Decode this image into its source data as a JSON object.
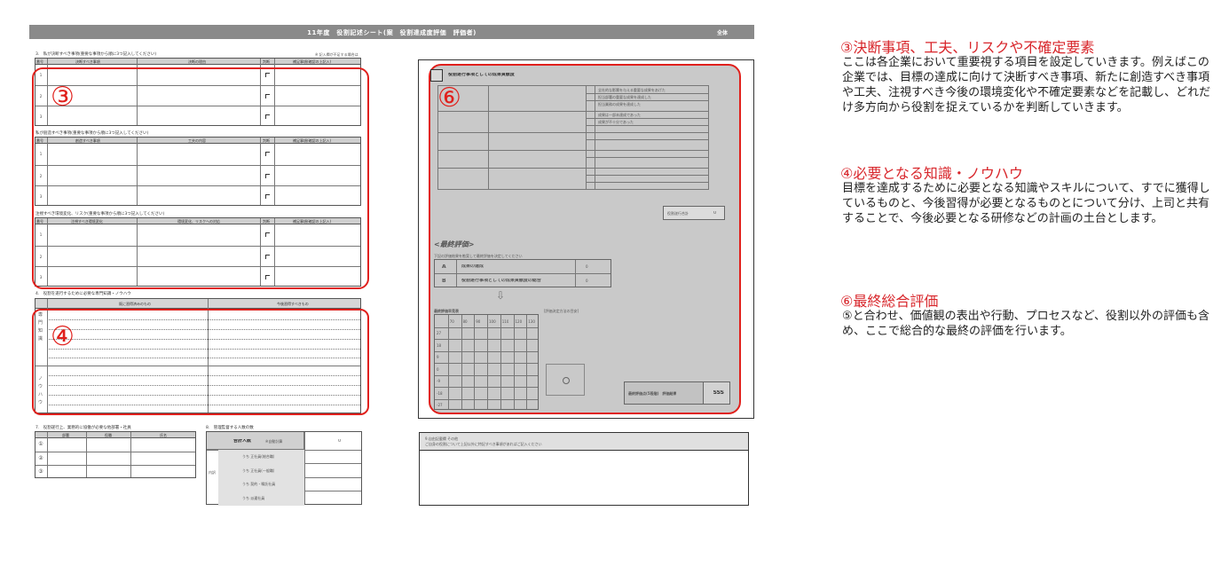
{
  "sheet": {
    "header_title": "11年度　役割記述シート(案　役割達成度評価　評価者)",
    "header_right": "全体",
    "sections": {
      "s3_label": "3.　私が決断すべき事項(重要な事項から順に3つ記入してください)",
      "s3_note": "※ 記入欄が不足する場合は",
      "s3_cols": [
        "番号",
        "決断すべき事項",
        "決断の理由",
        "判断",
        "補足事項(確認の上記入)"
      ],
      "s3b_label": "私が創造すべき事項(重要な事項から順に3つ記入してください)",
      "s3b_cols": [
        "番号",
        "創造すべき事項",
        "工夫の内容",
        "判断",
        "補足事項(確認の上記入)"
      ],
      "s3c_label": "注視すべき環境変化、リスク(重要な事項から順に3つ記入してください)",
      "s3c_cols": [
        "番号",
        "注視すべき環境変化",
        "環境変化、リスクへの対応",
        "判断",
        "補足事項(確認の上記入)"
      ],
      "s4_label": "4.　役割を遂行するために必要な専門知識・ノウハウ",
      "s4_cols": [
        "既に習得済みのもの",
        "今後習得すべきもの"
      ],
      "s4_side_a": "専門知識",
      "s4_side_b": "ノウハウ",
      "s7_label": "7.　役割遂行上、業務的に協働が必要な他部署・社員",
      "s7_cols": [
        "部署",
        "役職",
        "氏名"
      ],
      "s7_rows": [
        "①",
        "②",
        "③"
      ],
      "s8_label": "8.　管理監督する人数の数",
      "s8_total_label": "合計人数",
      "s8_total_note": "※自動計算",
      "s8_total_value": "0",
      "s8_side": "内訳",
      "s8_rows": [
        "うち 正社員(総合職)",
        "うち 正社員(一般職)",
        "うち 契約・嘱託社員",
        "うち 派遣社員"
      ],
      "s9_label": "9.自由記載欄 その他",
      "s9_note": "ご自身の役割について上記以外に特記すべき事項があればご記入ください"
    },
    "marks": {
      "three": "③",
      "four": "④",
      "six": "⑥"
    },
    "right": {
      "panel_title": "役割遂行事項としての成果貢献度",
      "rating_rows": [
        "全社的な影響を与える重要な成果をあげた",
        "担当部署の重要な成果を達成した",
        "担当業務の成果を達成した",
        "成果は一部未達成であった",
        "成果が不十分であった"
      ],
      "eval_box_label": "役割遂行合計",
      "eval_box_value": "0",
      "final_title": "<最終評価>",
      "final_note": "下記の評価結果を勘案して最終評価を決定してください",
      "final_rows": [
        {
          "mark": "A",
          "label": "成果の達成",
          "value": "0"
        },
        {
          "mark": "B",
          "label": "役割遂行事項としての成果貢献度の総合",
          "value": "0"
        }
      ],
      "matrix_title": "最終評価早見表",
      "matrix_head": [
        "70",
        "80",
        "90",
        "100",
        "110",
        "120",
        "130"
      ],
      "matrix_rows": [
        "27",
        "18",
        "9",
        "0",
        "-9",
        "-18",
        "-27"
      ],
      "matrix_side": "役割遂行",
      "guide_title": "[評価決定方法の目安]",
      "stamp_label": "最終評価点(5段階)　評価結果",
      "stamp_value": "SSS"
    }
  },
  "annotations": [
    {
      "title": "③決断事項、工夫、リスクや不確定要素",
      "body": "ここは各企業において重要視する項目を設定していきます。例えばこの企業では、目標の達成に向けて決断すべき事項、新たに創造すべき事項や工夫、注視すべき今後の環境変化や不確定要素などを記載し、どれだけ多方向から役割を捉えているかを判断していきます。"
    },
    {
      "title": "④必要となる知識・ノウハウ",
      "body": "目標を達成するために必要となる知識やスキルについて、すでに獲得しているものと、今後習得が必要となるものとについて分け、上司と共有することで、今後必要となる研修などの計画の土台とします。"
    },
    {
      "title": "⑥最終総合評価",
      "body": "⑤と合わせ、価値観の表出や行動、プロセスなど、役割以外の評価も含め、ここで総合的な最終の評価を行います。"
    }
  ]
}
